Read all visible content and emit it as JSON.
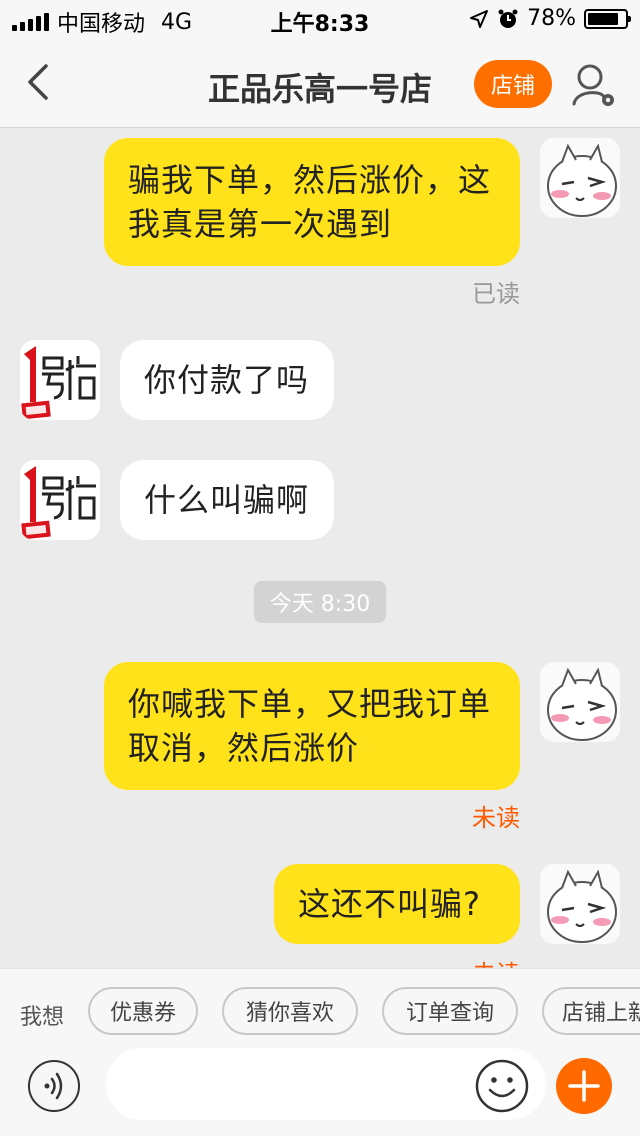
{
  "status_bar": {
    "carrier": "中国移动",
    "network": "4G",
    "time": "上午8:33",
    "battery": "78%"
  },
  "nav": {
    "title": "正品乐高一号店",
    "shop_button": "店铺"
  },
  "messages": [
    {
      "from": "me",
      "text_lines": [
        "骗我下单，然后涨价，这",
        "我真是第一次遇到"
      ],
      "status": "已读"
    },
    {
      "from": "shop",
      "text": "你付款了吗"
    },
    {
      "from": "shop",
      "text": "什么叫骗啊"
    },
    {
      "from": "me",
      "text_lines": [
        "你喊我下单，又把我订单",
        "取消，然后涨价"
      ],
      "status": "未读"
    },
    {
      "from": "me",
      "text": "这还不叫骗?",
      "status": "未读"
    }
  ],
  "time_divider": "今天 8:30",
  "suggestions": {
    "label": "我想",
    "chips": [
      "优惠券",
      "猜你喜欢",
      "订单查询",
      "店铺上新"
    ]
  },
  "colors": {
    "my_bubble": "#ffe21a",
    "their_bubble": "#ffffff",
    "accent": "#ff6a00",
    "unread": "#ff5a00"
  }
}
